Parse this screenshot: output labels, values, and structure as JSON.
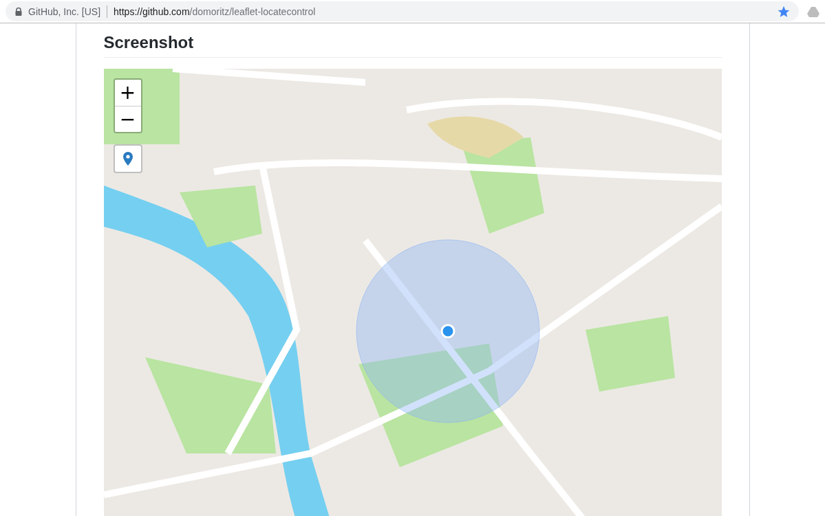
{
  "address_bar": {
    "site_identity": "GitHub, Inc. [US]",
    "url_host": "https://github.com",
    "url_path": "/domoritz/leaflet-locatecontrol",
    "bookmarked": true
  },
  "readme": {
    "heading": "Screenshot"
  },
  "map": {
    "zoom_in": "+",
    "zoom_out": "−"
  }
}
